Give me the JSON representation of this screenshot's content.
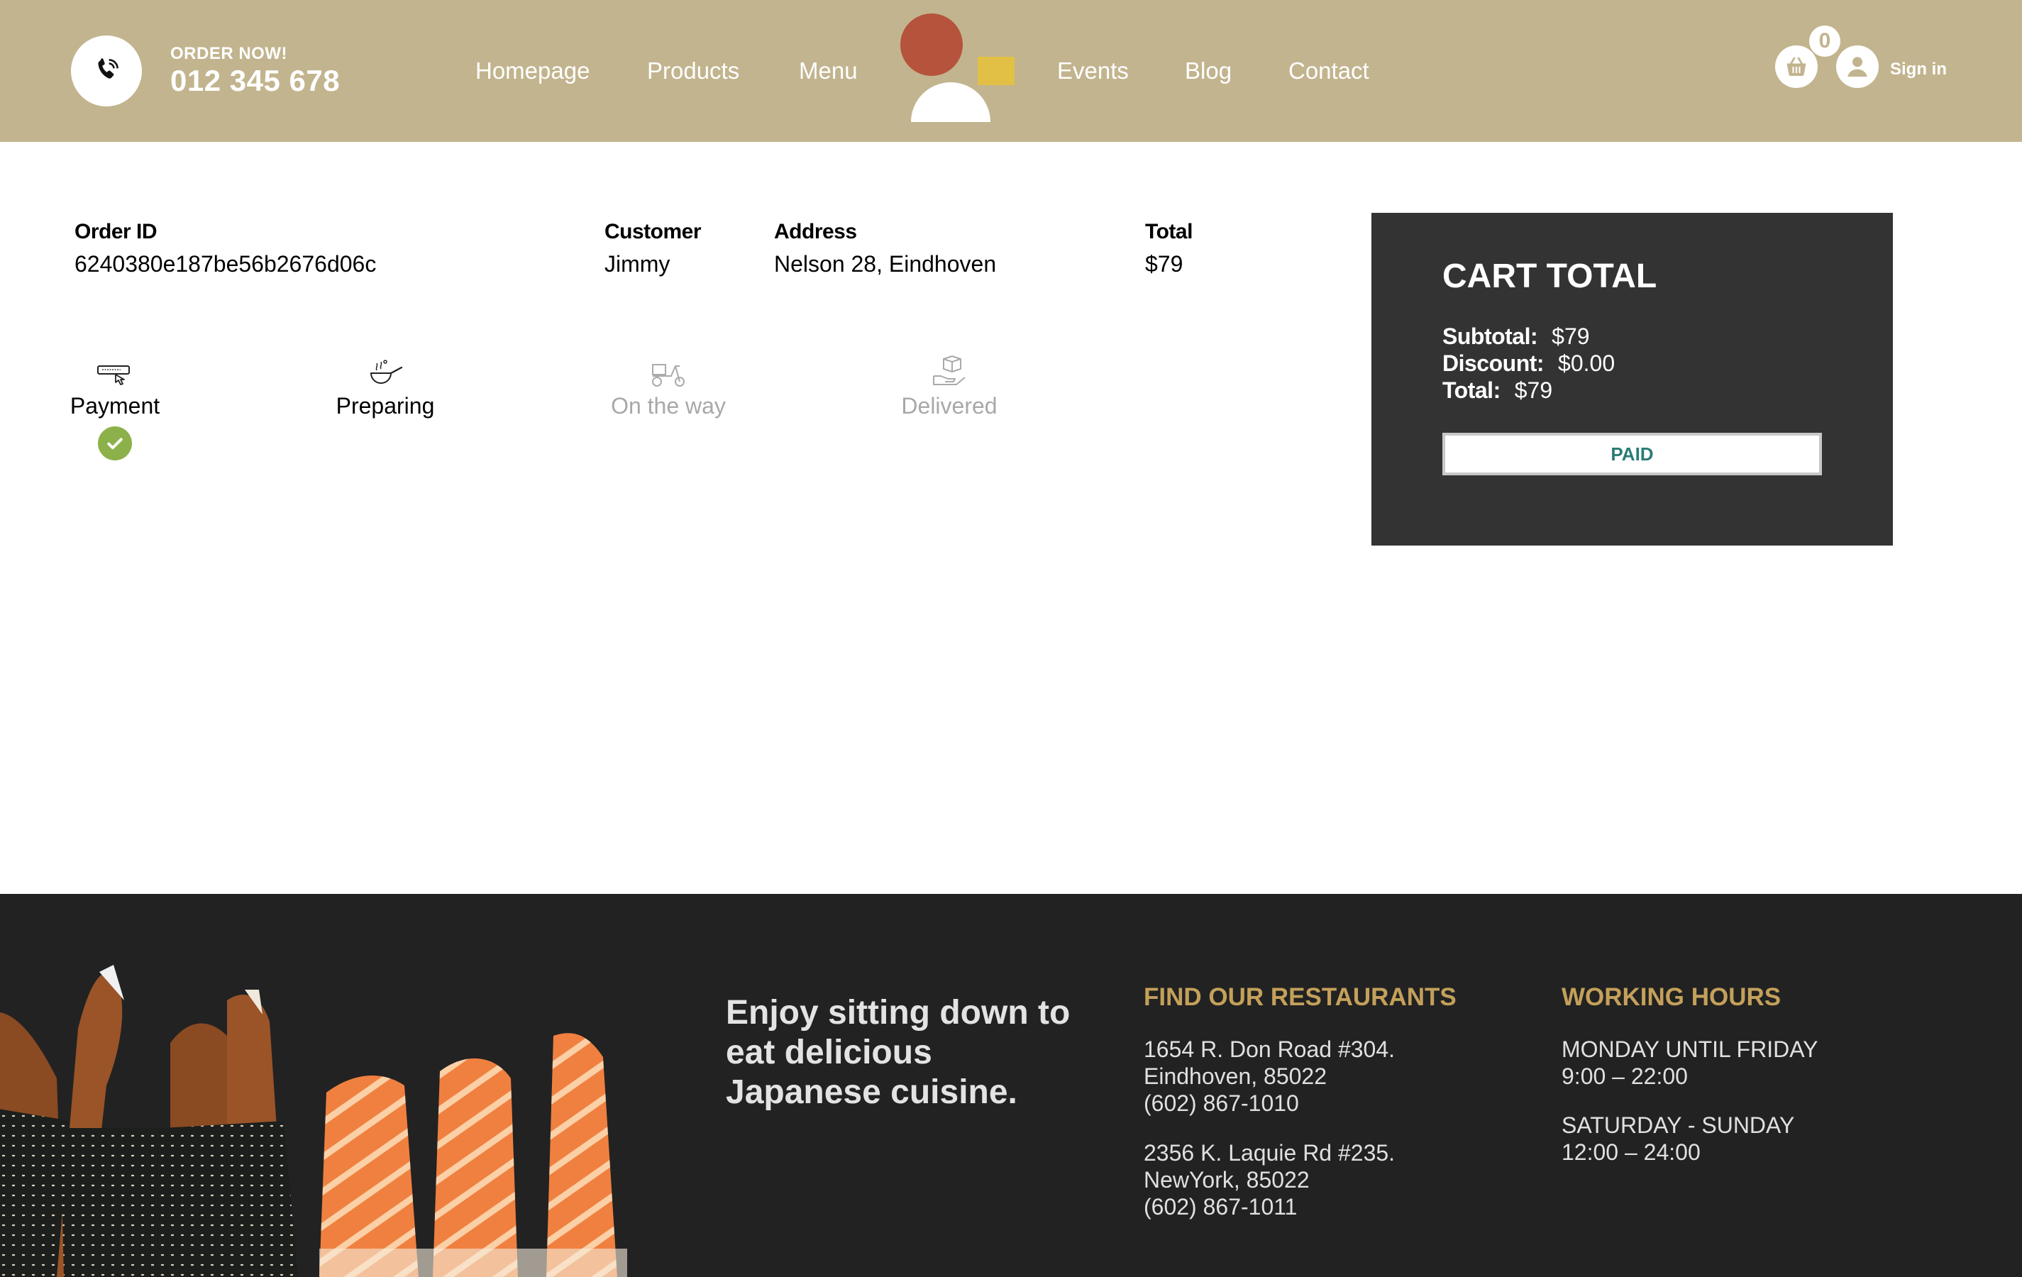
{
  "header": {
    "order_now": "ORDER NOW!",
    "phone": "012 345 678",
    "nav": [
      "Homepage",
      "Products",
      "Menu",
      "Events",
      "Blog",
      "Contact"
    ],
    "cart_count": "0",
    "sign_in": "Sign in"
  },
  "order": {
    "id_label": "Order ID",
    "id_value": "6240380e187be56b2676d06c",
    "customer_label": "Customer",
    "customer_value": "Jimmy",
    "address_label": "Address",
    "address_value": "Nelson 28, Eindhoven",
    "total_label": "Total",
    "total_value": "$79"
  },
  "status_steps": [
    {
      "label": "Payment",
      "state": "done",
      "icon": "payment-icon"
    },
    {
      "label": "Preparing",
      "state": "done",
      "icon": "cooking-pan-icon"
    },
    {
      "label": "On the way",
      "state": "pending",
      "icon": "scooter-icon"
    },
    {
      "label": "Delivered",
      "state": "pending",
      "icon": "package-icon"
    }
  ],
  "cart_total": {
    "title": "CART TOTAL",
    "subtotal_label": "Subtotal:",
    "subtotal_value": "$79",
    "discount_label": "Discount:",
    "discount_value": "$0.00",
    "total_label": "Total:",
    "total_value": "$79",
    "paid_button": "PAID"
  },
  "footer": {
    "slogan": "Enjoy sitting down to eat delicious Japanese cuisine.",
    "restaurants_heading": "FIND OUR RESTAURANTS",
    "restaurants": [
      {
        "line1": "1654 R. Don Road #304.",
        "line2": "Eindhoven, 85022",
        "line3": "(602) 867-1010"
      },
      {
        "line1": "2356 K. Laquie Rd #235.",
        "line2": "NewYork, 85022",
        "line3": "(602) 867-1011"
      }
    ],
    "hours_heading": "WORKING HOURS",
    "hours": [
      {
        "days": "MONDAY UNTIL FRIDAY",
        "time": "9:00 – 22:00"
      },
      {
        "days": "SATURDAY - SUNDAY",
        "time": "12:00 – 24:00"
      }
    ]
  },
  "colors": {
    "header_bg": "#c2b48e",
    "accent_gold": "#c4a05a",
    "logo_red": "#b5533c",
    "logo_yellow": "#e1c045",
    "check_green": "#8db14a",
    "paid_text": "#2a7c74",
    "dark_panel": "#333333",
    "footer_bg": "#222222"
  }
}
